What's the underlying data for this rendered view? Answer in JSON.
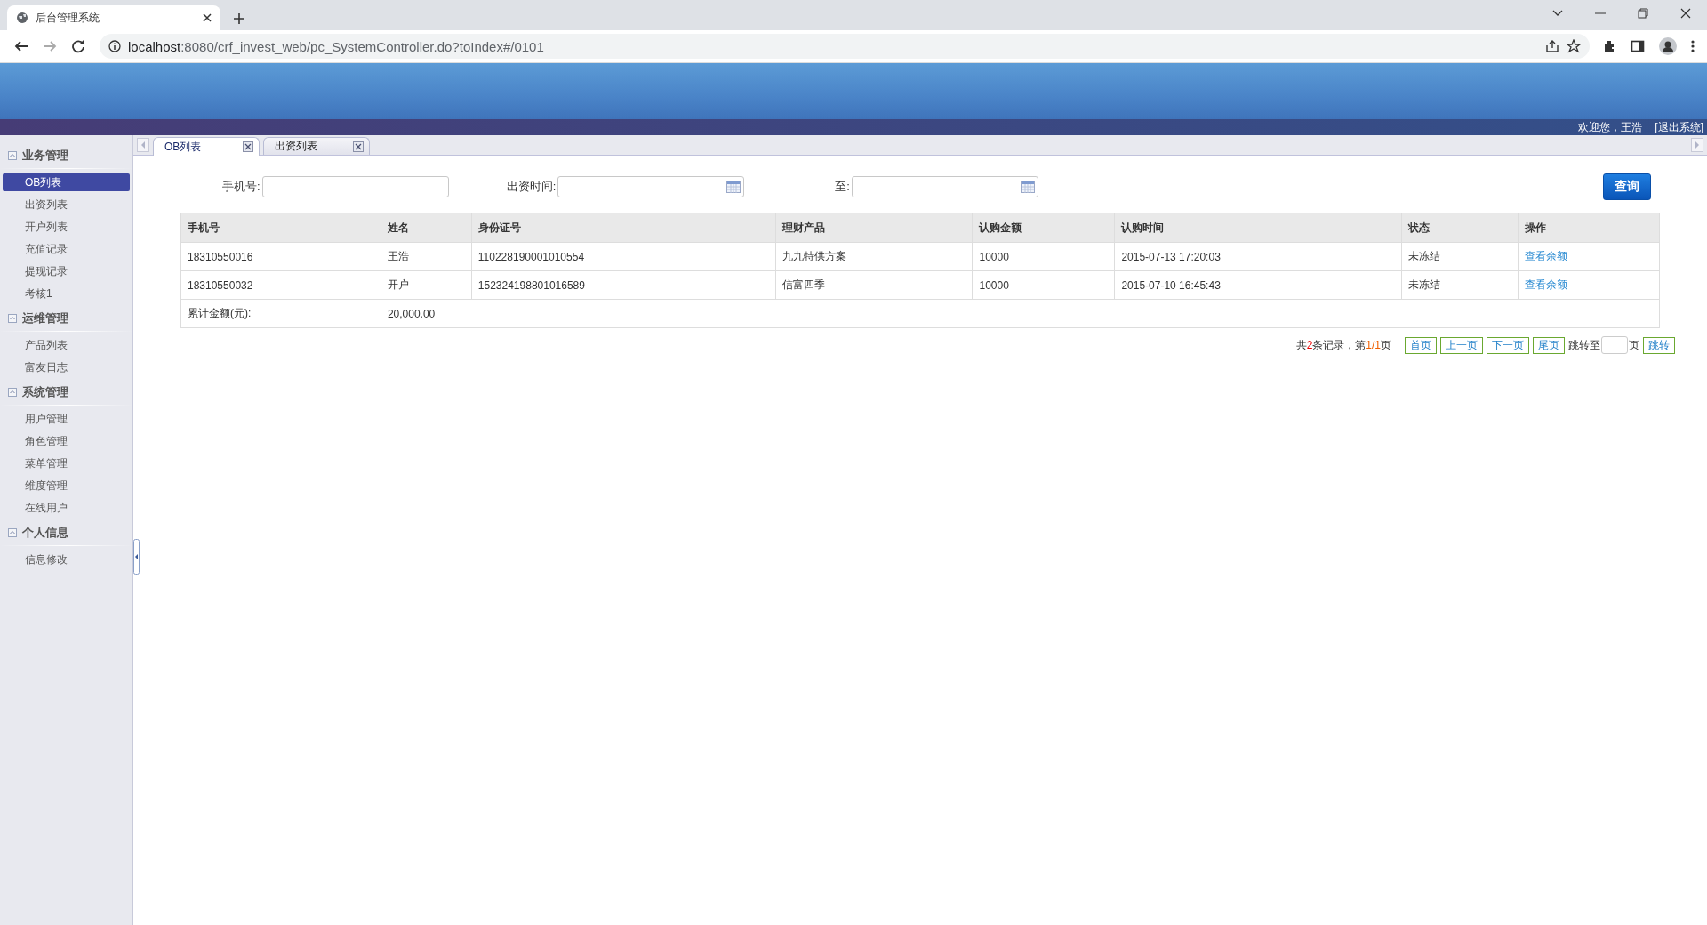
{
  "browser": {
    "tab_title": "后台管理系统",
    "url_host": "localhost",
    "url_rest": ":8080/crf_invest_web/pc_SystemController.do?toIndex#/0101"
  },
  "header": {
    "welcome": "欢迎您，王浩",
    "logout": "[退出系统]"
  },
  "sidebar": {
    "groups": [
      {
        "title": "业务管理",
        "expanded": true,
        "items": [
          {
            "label": "OB列表",
            "selected": true
          },
          {
            "label": "出资列表",
            "selected": false
          },
          {
            "label": "开户列表",
            "selected": false
          },
          {
            "label": "充值记录",
            "selected": false
          },
          {
            "label": "提现记录",
            "selected": false
          },
          {
            "label": "考核1",
            "selected": false
          }
        ]
      },
      {
        "title": "运维管理",
        "expanded": true,
        "items": [
          {
            "label": "产品列表",
            "selected": false
          },
          {
            "label": "富友日志",
            "selected": false
          }
        ]
      },
      {
        "title": "系统管理",
        "expanded": true,
        "items": [
          {
            "label": "用户管理",
            "selected": false
          },
          {
            "label": "角色管理",
            "selected": false
          },
          {
            "label": "菜单管理",
            "selected": false
          },
          {
            "label": "维度管理",
            "selected": false
          },
          {
            "label": "在线用户",
            "selected": false
          }
        ]
      },
      {
        "title": "个人信息",
        "expanded": true,
        "items": [
          {
            "label": "信息修改",
            "selected": false
          }
        ]
      }
    ]
  },
  "tabs": [
    {
      "label": "OB列表",
      "selected": true
    },
    {
      "label": "出资列表",
      "selected": false
    }
  ],
  "filters": {
    "phone_label": "手机号:",
    "date_label": "出资时间:",
    "to_label": "至:",
    "search_button": "查询"
  },
  "table": {
    "columns": [
      "手机号",
      "姓名",
      "身份证号",
      "理财产品",
      "认购金额",
      "认购时间",
      "状态",
      "操作"
    ],
    "rows": [
      {
        "cells": [
          "18310550016",
          "王浩",
          "110228190001010554",
          "九九特供方案",
          "10000",
          "2015-07-13 17:20:03",
          "未冻结"
        ],
        "action": "查看余额"
      },
      {
        "cells": [
          "18310550032",
          "开户",
          "152324198801016589",
          "信富四季",
          "10000",
          "2015-07-10 16:45:43",
          "未冻结"
        ],
        "action": "查看余额"
      }
    ],
    "total_label": "累计金额(元):",
    "total_value": "20,000.00"
  },
  "pagination": {
    "summary_prefix": "共",
    "record_count": "2",
    "summary_mid": "条记录，第",
    "page_info": "1/1",
    "summary_suffix": "页",
    "buttons": [
      "首页",
      "上一页",
      "下一页",
      "尾页"
    ],
    "jump_label": "跳转至",
    "page_unit": "页",
    "jump_button": "跳转"
  }
}
